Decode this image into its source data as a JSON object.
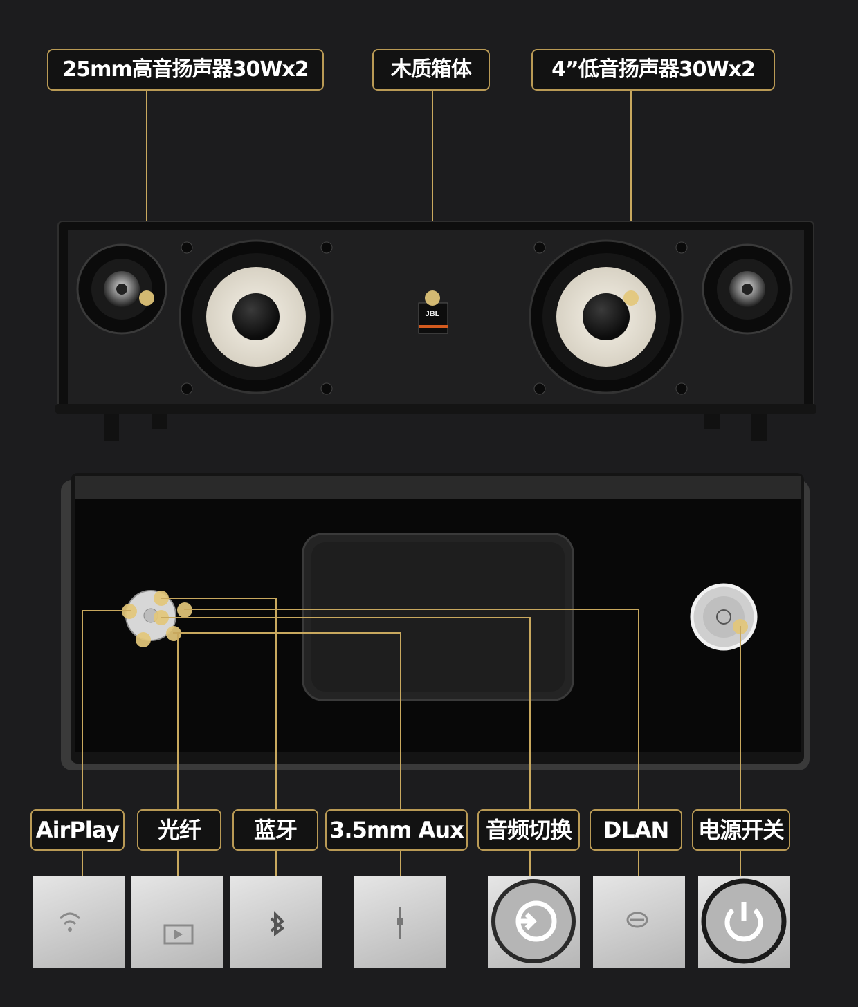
{
  "top_labels": {
    "tweeter": "25mm高音扬声器30Wx2",
    "cabinet": "木质箱体",
    "woofer": "4”低音扬声器30Wx2"
  },
  "logo_text": "JBL",
  "bottom_labels": [
    {
      "id": "airplay",
      "label": "AirPlay",
      "icon": "wifi-icon"
    },
    {
      "id": "optical",
      "label": "光纤",
      "icon": "screen-play-icon"
    },
    {
      "id": "bluetooth",
      "label": "蓝牙",
      "icon": "bluetooth-icon"
    },
    {
      "id": "aux",
      "label": "3.5mm Aux",
      "icon": "aux-jack-icon"
    },
    {
      "id": "source",
      "label": "音频切换",
      "icon": "input-switch-icon"
    },
    {
      "id": "dlan",
      "label": "DLAN",
      "icon": "link-icon"
    },
    {
      "id": "power",
      "label": "电源开关",
      "icon": "power-icon"
    }
  ],
  "colors": {
    "accent": "#c8a85e",
    "background": "#1c1c1e"
  }
}
